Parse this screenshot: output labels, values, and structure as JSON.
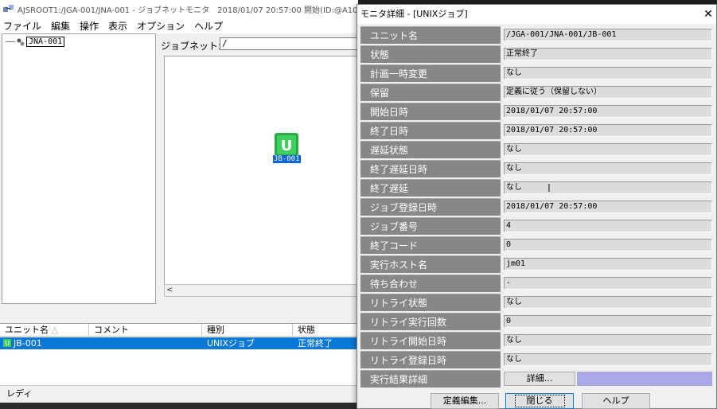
{
  "main": {
    "title": "AJSROOT1:/JGA-001/JNA-001 - ジョブネットモニタ　2018/01/07 20:57:00 開始(ID:@A10",
    "menu": [
      "ファイル",
      "編集",
      "操作",
      "表示",
      "オプション",
      "ヘルプ"
    ],
    "tree_root": "JNA-001",
    "jobnet_label": "ジョブネット:",
    "jobnet_value": "/",
    "job_icon_label": "JB-001",
    "list_columns": [
      "ユニット名",
      "コメント",
      "種別",
      "状態"
    ],
    "list_row": {
      "name": "JB-001",
      "comment": "",
      "type": "UNIXジョブ",
      "status": "正常終了"
    },
    "status_text": "レディ"
  },
  "dialog": {
    "title": "モニタ詳細 - [UNIXジョブ]",
    "fields": [
      {
        "label": "ユニット名",
        "value": "/JGA-001/JNA-001/JB-001"
      },
      {
        "label": "状態",
        "value": "正常終了"
      },
      {
        "label": "計画一時変更",
        "value": "なし"
      },
      {
        "label": "保留",
        "value": "定義に従う（保留しない）"
      },
      {
        "label": "開始日時",
        "value": "2018/01/07 20:57:00"
      },
      {
        "label": "終了日時",
        "value": "2018/01/07 20:57:00"
      },
      {
        "label": "遅延状態",
        "value": "なし"
      },
      {
        "label": "終了遅延日時",
        "value": "なし"
      },
      {
        "label": "終了遅延",
        "value": "なし"
      },
      {
        "label": "ジョブ登録日時",
        "value": "2018/01/07 20:57:00"
      },
      {
        "label": "ジョブ番号",
        "value": "4"
      },
      {
        "label": "終了コード",
        "value": "0"
      },
      {
        "label": "実行ホスト名",
        "value": "jm01"
      },
      {
        "label": "待ち合わせ",
        "value": "-"
      },
      {
        "label": "リトライ状態",
        "value": "なし"
      },
      {
        "label": "リトライ実行回数",
        "value": "0"
      },
      {
        "label": "リトライ開始日時",
        "value": "なし"
      },
      {
        "label": "リトライ登録日時",
        "value": "なし"
      }
    ],
    "result_label": "実行結果詳細",
    "result_button": "詳細...",
    "buttons": {
      "edit": "定義編集...",
      "close": "閉じる",
      "help": "ヘルプ"
    },
    "close_glyph": "✕"
  },
  "colors": {
    "label_bg": "#878787",
    "selection": "#0a78d7",
    "job_icon": "#2db84a"
  }
}
